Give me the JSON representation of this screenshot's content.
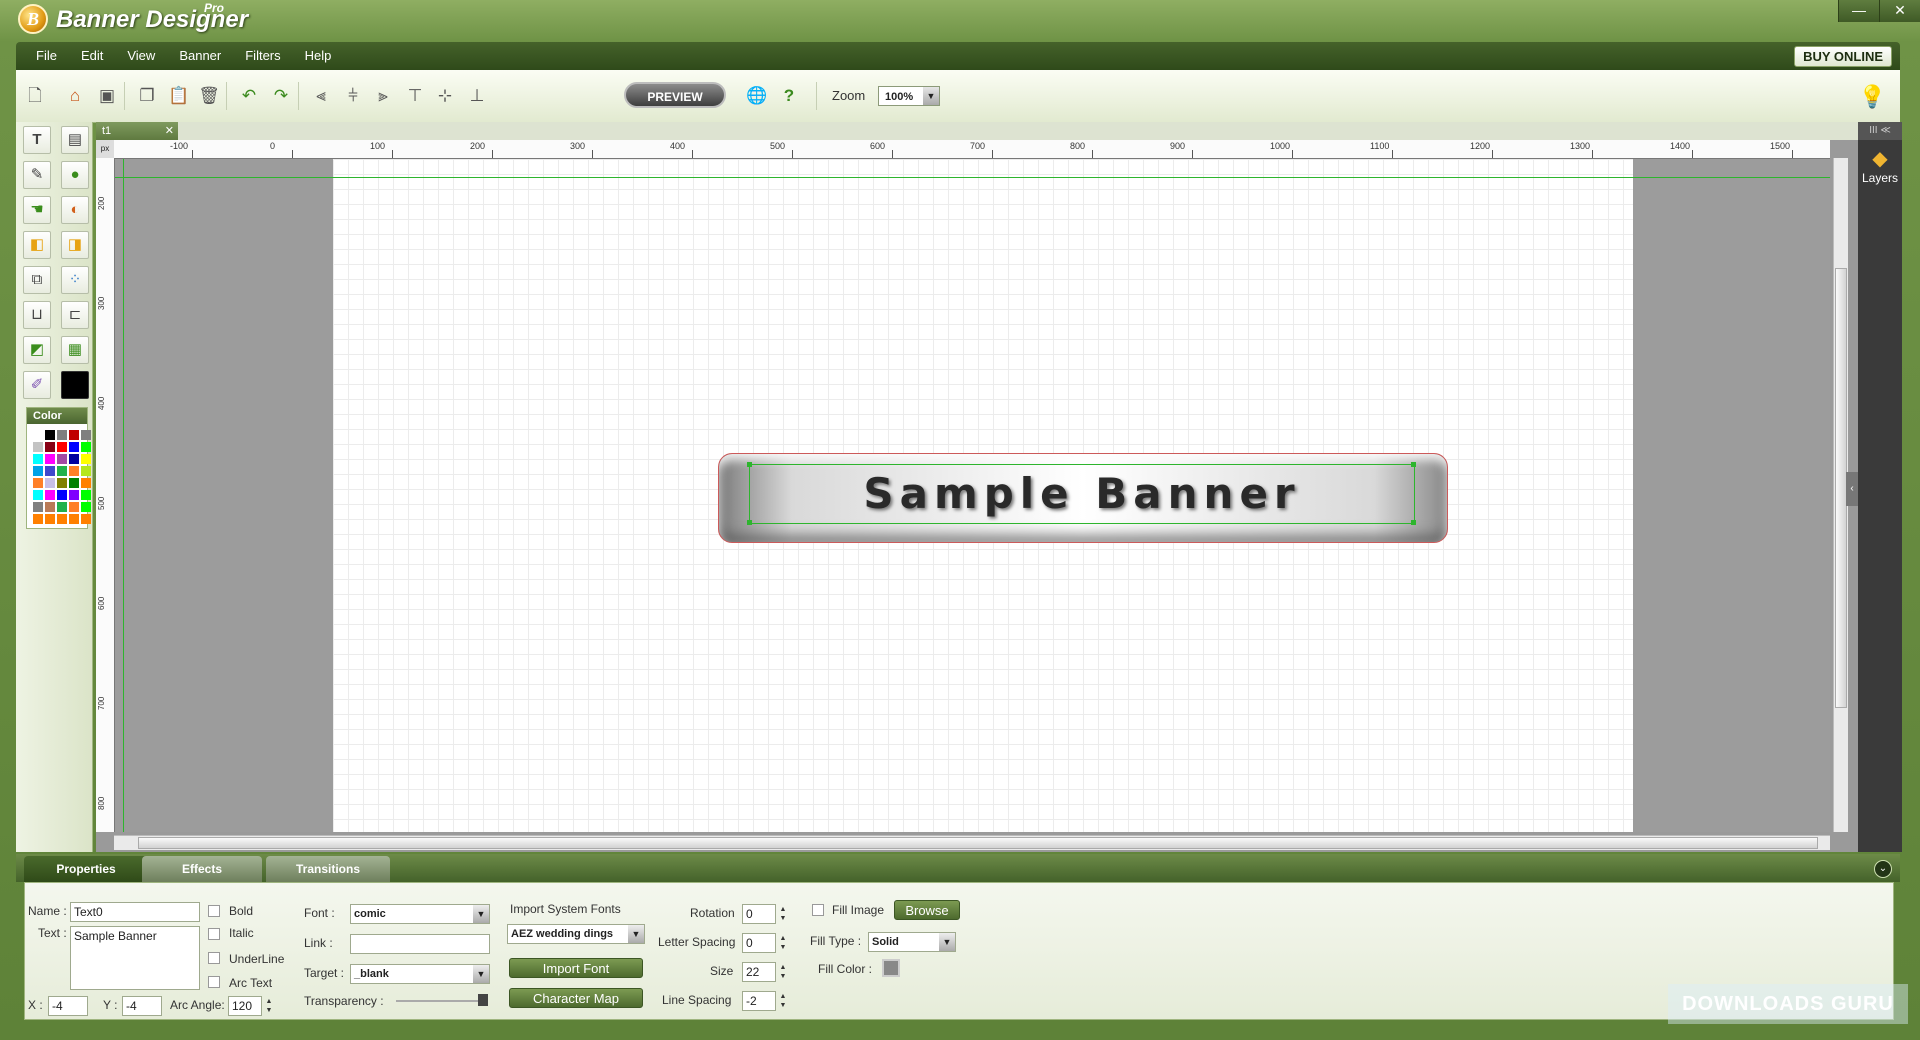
{
  "app": {
    "title": "Banner Designer",
    "edition": "Pro",
    "logo_letter": "B"
  },
  "window_controls": {
    "minimize": "—",
    "close": "✕"
  },
  "menu": {
    "items": [
      "File",
      "Edit",
      "View",
      "Banner",
      "Filters",
      "Help"
    ],
    "buy_online": "BUY ONLINE"
  },
  "toolbar": {
    "preview_label": "PREVIEW",
    "zoom_label": "Zoom",
    "zoom_value": "100%"
  },
  "palette": {
    "color_label": "Color",
    "swatches": [
      "#ffffff",
      "#000000",
      "#7f7f7f",
      "#c00000",
      "#7f7f7f",
      "#c3c3c3",
      "#880015",
      "#ff0000",
      "#0000ff",
      "#00ff00",
      "#00ffff",
      "#ff00ff",
      "#a349a4",
      "#0000a0",
      "#ffff00",
      "#00a2e8",
      "#3f48cc",
      "#22b14c",
      "#ff7f27",
      "#b5e61d",
      "#ff7f27",
      "#c8bfe7",
      "#808000",
      "#008000",
      "#ff8000",
      "#00ffff",
      "#ff00ff",
      "#0000ff",
      "#8000ff",
      "#00ff00",
      "#808080",
      "#b97a57",
      "#22b14c",
      "#ff7f27",
      "#00ff00",
      "#ff8000",
      "#ff8000",
      "#ff8000",
      "#ff8000",
      "#ff8000"
    ]
  },
  "document": {
    "tab_label": "t1",
    "ruler_h_labels": [
      "-100",
      "0",
      "100",
      "200",
      "300",
      "400",
      "500",
      "600",
      "700",
      "800",
      "900",
      "1000",
      "1100",
      "1200",
      "1300",
      "1400",
      "1500"
    ],
    "ruler_v_labels": [
      "200",
      "300",
      "400",
      "500",
      "600",
      "700",
      "800"
    ],
    "ruler_corner": "px",
    "banner_text": "Sample Banner"
  },
  "layers": {
    "label": "Layers",
    "header": "III ≪"
  },
  "bottom_tabs": [
    "Properties",
    "Effects",
    "Transitions"
  ],
  "properties": {
    "name_label": "Name :",
    "name_value": "Text0",
    "text_label": "Text :",
    "text_value": "Sample Banner",
    "bold": "Bold",
    "italic": "Italic",
    "underline": "UnderLine",
    "arc_text": "Arc Text",
    "x_label": "X :",
    "x_value": "-4",
    "y_label": "Y :",
    "y_value": "-4",
    "arc_angle_label": "Arc Angle:",
    "arc_angle_value": "120",
    "font_label": "Font :",
    "font_value": "comic",
    "link_label": "Link :",
    "link_value": "",
    "target_label": "Target :",
    "target_value": "_blank",
    "transparency_label": "Transparency :",
    "transparency_level": 0.95,
    "import_system_fonts": "Import System Fonts",
    "system_font_value": "AEZ wedding dings",
    "import_font_button": "Import Font",
    "character_map_button": "Character Map",
    "rotation_label": "Rotation",
    "rotation_value": "0",
    "letter_spacing_label": "Letter Spacing",
    "letter_spacing_value": "0",
    "size_label": "Size",
    "size_value": "22",
    "line_spacing_label": "Line Spacing",
    "line_spacing_value": "-2",
    "fill_image_label": "Fill Image",
    "browse_button": "Browse",
    "fill_type_label": "Fill Type :",
    "fill_type_value": "Solid",
    "fill_color_label": "Fill Color :"
  },
  "watermark": "DOWNLOADS GURU"
}
